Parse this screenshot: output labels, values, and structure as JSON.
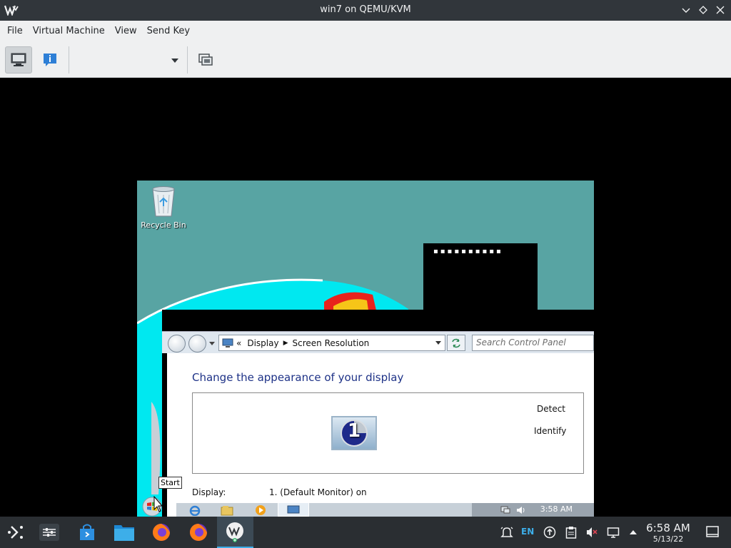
{
  "window": {
    "title": "win7 on QEMU/KVM"
  },
  "menu": [
    "File",
    "Virtual Machine",
    "View",
    "Send Key"
  ],
  "toolbar": {
    "icons": [
      "console-icon",
      "details-info-icon",
      "dropdown-chevron-icon",
      "snapshot-icon"
    ]
  },
  "guest": {
    "desktop_icons": [
      {
        "label": "Recycle Bin",
        "icon": "recycle-bin-icon"
      }
    ],
    "control_panel": {
      "breadcrumb_root_icon": "control-panel-icon",
      "breadcrumb_prefix": "«",
      "breadcrumb": [
        "Display",
        "Screen Resolution"
      ],
      "search_placeholder": "Search Control Panel",
      "heading": "Change the appearance of your display",
      "monitor_number": "1",
      "detect_label": "Detect",
      "identify_label": "Identify",
      "display_label": "Display:",
      "display_value": "1. (Default Monitor) on"
    },
    "start_tooltip": "Start",
    "clock": "3:58 AM"
  },
  "kde_panel": {
    "launchers": [
      "application-launcher-icon",
      "system-settings-icon",
      "discover-store-icon",
      "file-manager-icon",
      "firefox-icon",
      "firefox-icon",
      "virt-manager-icon"
    ],
    "keyboard_layout": "EN",
    "tray_icons": [
      "notifications-icon",
      "updates-icon",
      "clipboard-icon",
      "volume-muted-icon",
      "network-icon",
      "expand-tray-icon"
    ],
    "time": "6:58 AM",
    "date": "5/13/22"
  },
  "colors": {
    "titlebar": "#31363b",
    "menubar": "#eff0f1",
    "guest_wallpaper": "#58a4a3",
    "panel": "#2a2e32",
    "accent": "#3daee9",
    "cp_heading": "#1e3287"
  }
}
